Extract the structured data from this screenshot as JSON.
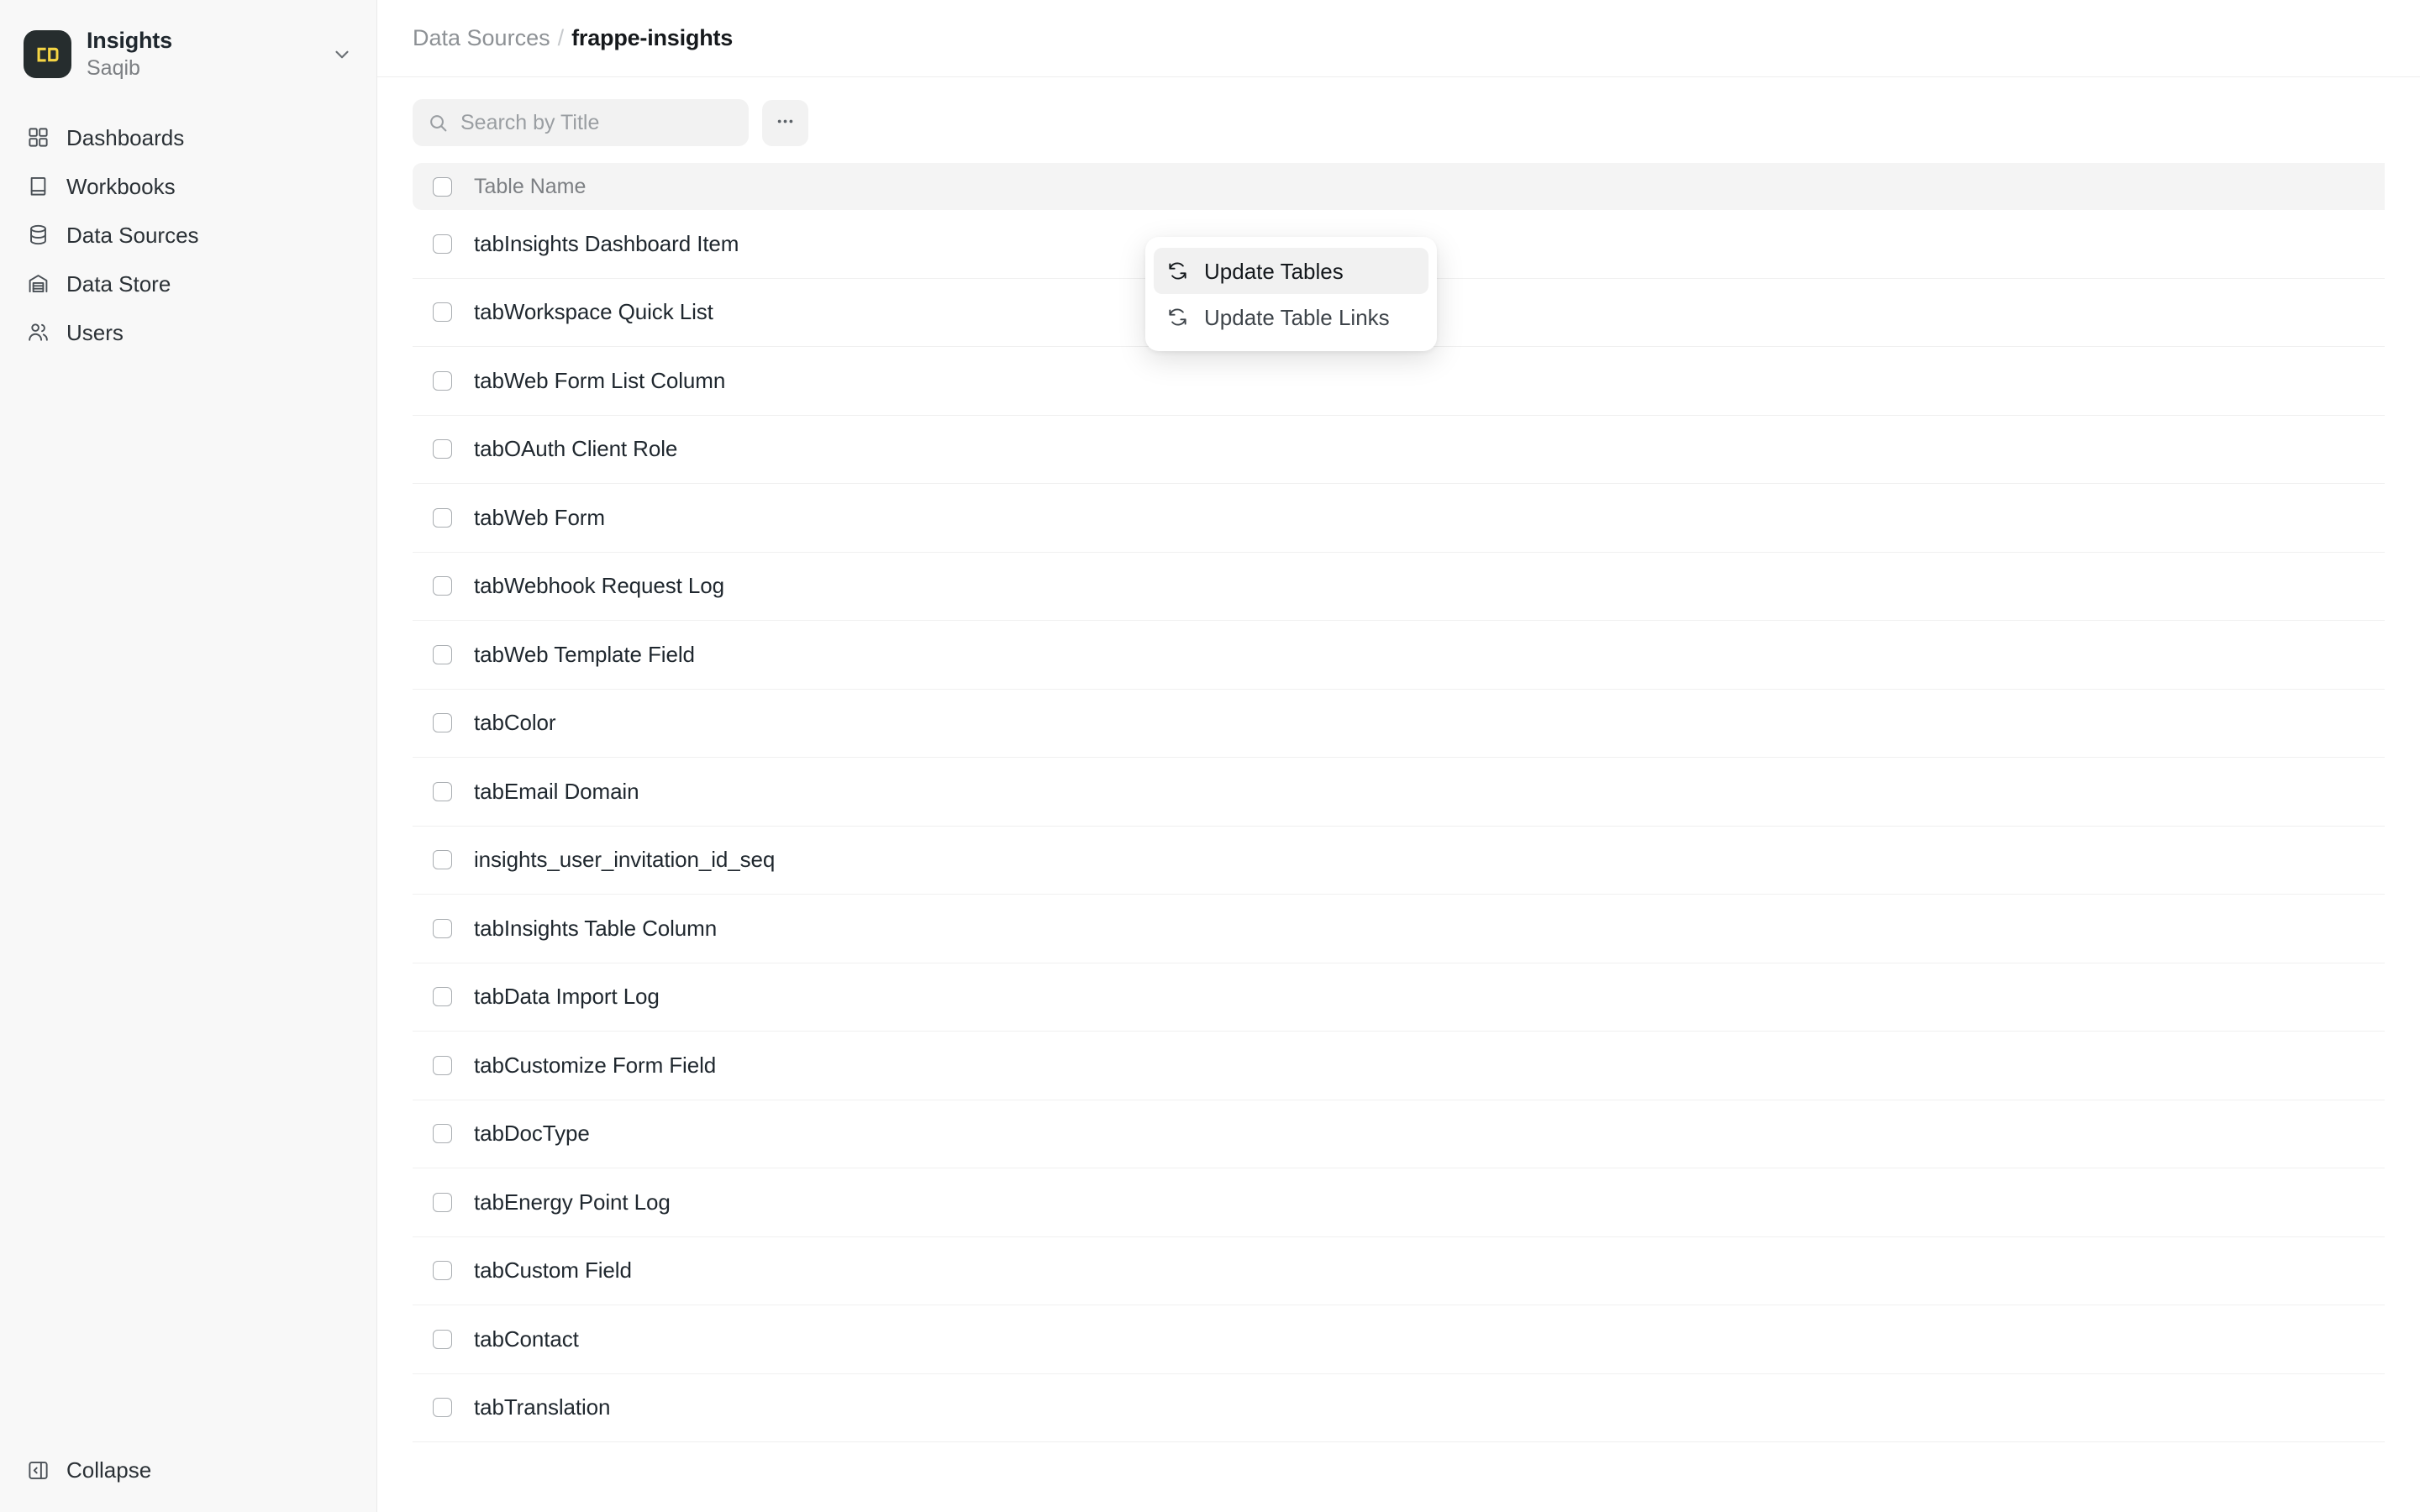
{
  "sidebar": {
    "workspace": {
      "title": "Insights",
      "subtitle": "Saqib",
      "logo_icon": "insights-logo-icon",
      "chevron_icon": "chevron-down-icon",
      "logo_bg": "#262d2e",
      "logo_fg": "#f5d544"
    },
    "items": [
      {
        "label": "Dashboards",
        "icon": "grid-squares-icon"
      },
      {
        "label": "Workbooks",
        "icon": "book-icon"
      },
      {
        "label": "Data Sources",
        "icon": "database-icon"
      },
      {
        "label": "Data Store",
        "icon": "warehouse-icon"
      },
      {
        "label": "Users",
        "icon": "users-icon"
      }
    ],
    "collapse": {
      "label": "Collapse",
      "icon": "panel-left-close-icon"
    }
  },
  "header": {
    "breadcrumb": {
      "parent": "Data Sources",
      "separator": "/",
      "current": "frappe-insights"
    }
  },
  "toolbar": {
    "search": {
      "placeholder": "Search by Title",
      "value": "",
      "icon": "search-icon"
    },
    "more_button": {
      "label": "•••",
      "icon": "ellipsis-horizontal-icon"
    }
  },
  "dropdown": {
    "open": true,
    "items": [
      {
        "label": "Update Tables",
        "icon": "refresh-icon",
        "active": true
      },
      {
        "label": "Update Table Links",
        "icon": "refresh-icon",
        "active": false
      }
    ]
  },
  "table": {
    "columns": [
      "Table Name"
    ],
    "select_all_checked": false,
    "rows": [
      {
        "name": "tabInsights Dashboard Item",
        "checked": false
      },
      {
        "name": "tabWorkspace Quick List",
        "checked": false
      },
      {
        "name": "tabWeb Form List Column",
        "checked": false
      },
      {
        "name": "tabOAuth Client Role",
        "checked": false
      },
      {
        "name": "tabWeb Form",
        "checked": false
      },
      {
        "name": "tabWebhook Request Log",
        "checked": false
      },
      {
        "name": "tabWeb Template Field",
        "checked": false
      },
      {
        "name": "tabColor",
        "checked": false
      },
      {
        "name": "tabEmail Domain",
        "checked": false
      },
      {
        "name": "insights_user_invitation_id_seq",
        "checked": false
      },
      {
        "name": "tabInsights Table Column",
        "checked": false
      },
      {
        "name": "tabData Import Log",
        "checked": false
      },
      {
        "name": "tabCustomize Form Field",
        "checked": false
      },
      {
        "name": "tabDocType",
        "checked": false
      },
      {
        "name": "tabEnergy Point Log",
        "checked": false
      },
      {
        "name": "tabCustom Field",
        "checked": false
      },
      {
        "name": "tabContact",
        "checked": false
      },
      {
        "name": "tabTranslation",
        "checked": false
      }
    ]
  },
  "colors": {
    "sidebar_bg": "#f8f8f8",
    "accent_yellow": "#f5d544",
    "text_primary": "#1f272e",
    "text_muted": "#8d9195",
    "row_border": "#f0f0f0",
    "header_bg": "#f4f4f4"
  }
}
